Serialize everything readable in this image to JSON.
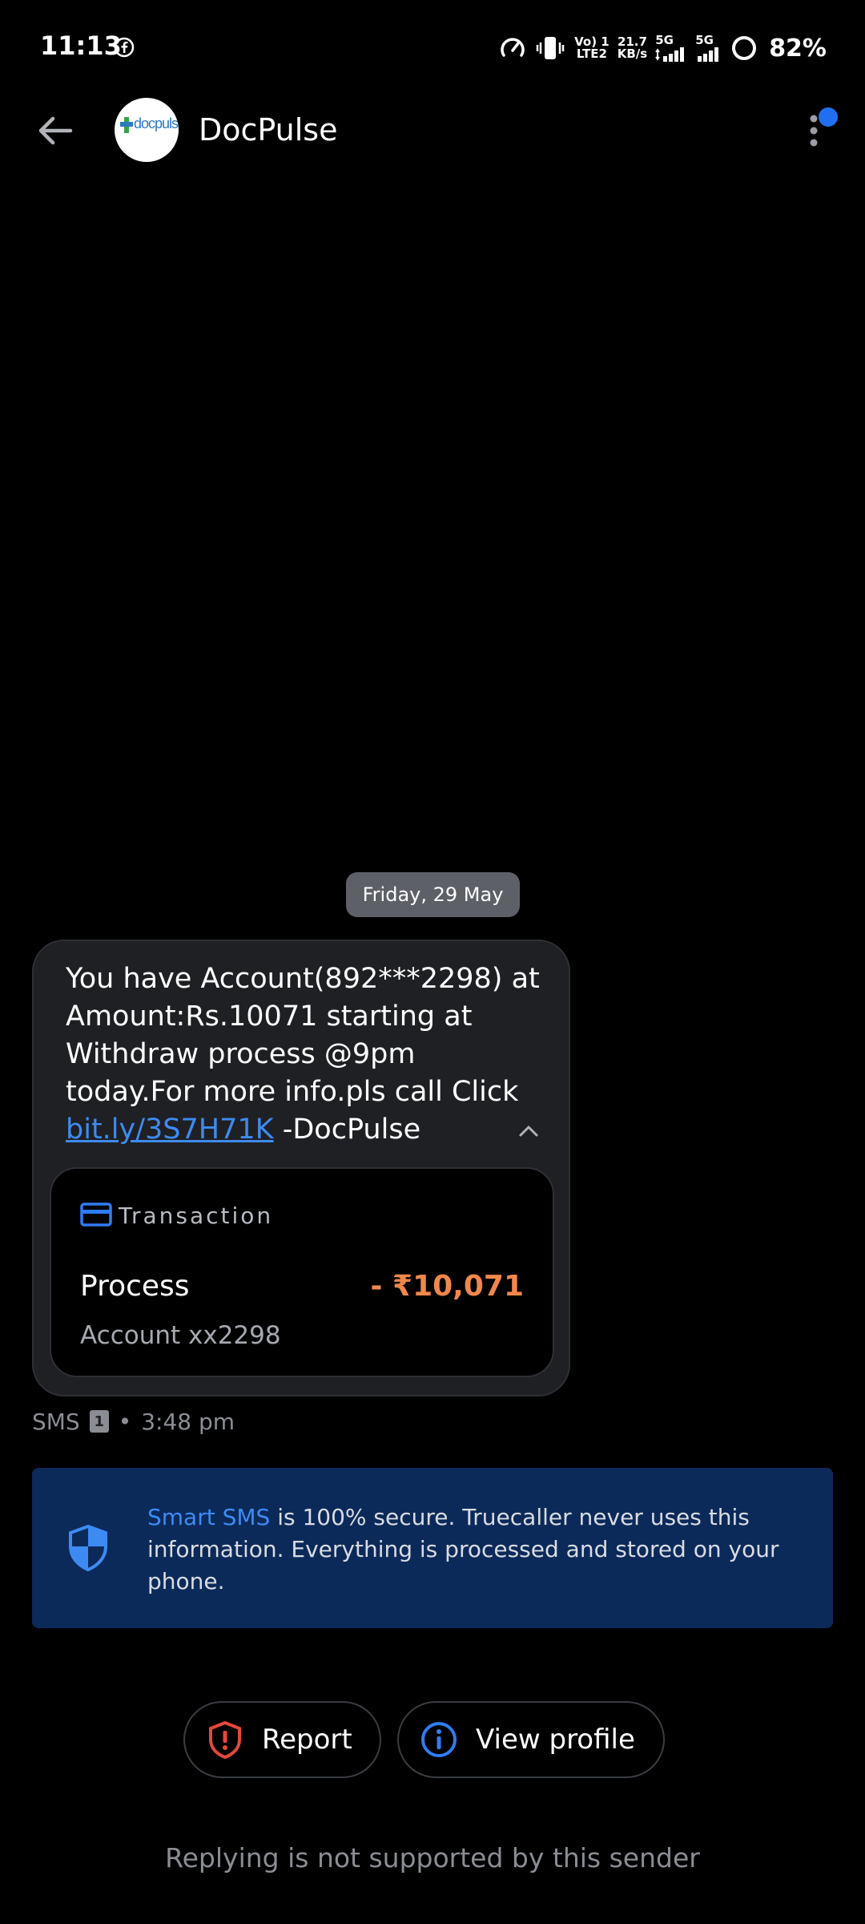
{
  "status_bar": {
    "time": "11:13",
    "volte_line1": "Vo) 1",
    "volte_line2": "LTE2",
    "speed_value": "21.7",
    "speed_unit": "KB/s",
    "net1": "5G",
    "net2": "5G",
    "battery": "82%"
  },
  "header": {
    "sender_name": "DocPulse",
    "avatar_text": "docpulse"
  },
  "conversation": {
    "date_chip": "Friday, 29 May",
    "message": {
      "text_before_link": "You have Account(892***2298) at Amount:Rs.10071 starting at Withdraw process @9pm today.For more info.pls call Click ",
      "link_text": "bit.ly/3S7H71K",
      "text_after_link": " -DocPulse"
    },
    "transaction_card": {
      "label": "Transaction",
      "title": "Process",
      "amount": "- ₹10,071",
      "account": "Account xx2298"
    },
    "meta": {
      "channel": "SMS",
      "sim": "1",
      "separator": "•",
      "time": "3:48 pm"
    }
  },
  "smart_sms_banner": {
    "highlight": "Smart SMS",
    "text": " is 100% secure. Truecaller never uses this information. Everything is processed and stored on your phone."
  },
  "actions": {
    "report_label": "Report",
    "view_profile_label": "View profile"
  },
  "footer": {
    "reply_note": "Replying is not supported by this sender"
  },
  "colors": {
    "background": "#000000",
    "bubble": "#1f2023",
    "link": "#3d8bf2",
    "amount": "#f0874c",
    "banner": "#0b2a5a",
    "report_icon": "#e5483a",
    "accent": "#1f6ff0"
  },
  "icons": {
    "back": "arrow-left-icon",
    "menu": "more-vertical-icon",
    "card": "credit-card-icon",
    "shield": "shield-icon",
    "report": "alert-shield-icon",
    "info": "info-circle-icon",
    "collapse": "chevron-up-icon"
  }
}
